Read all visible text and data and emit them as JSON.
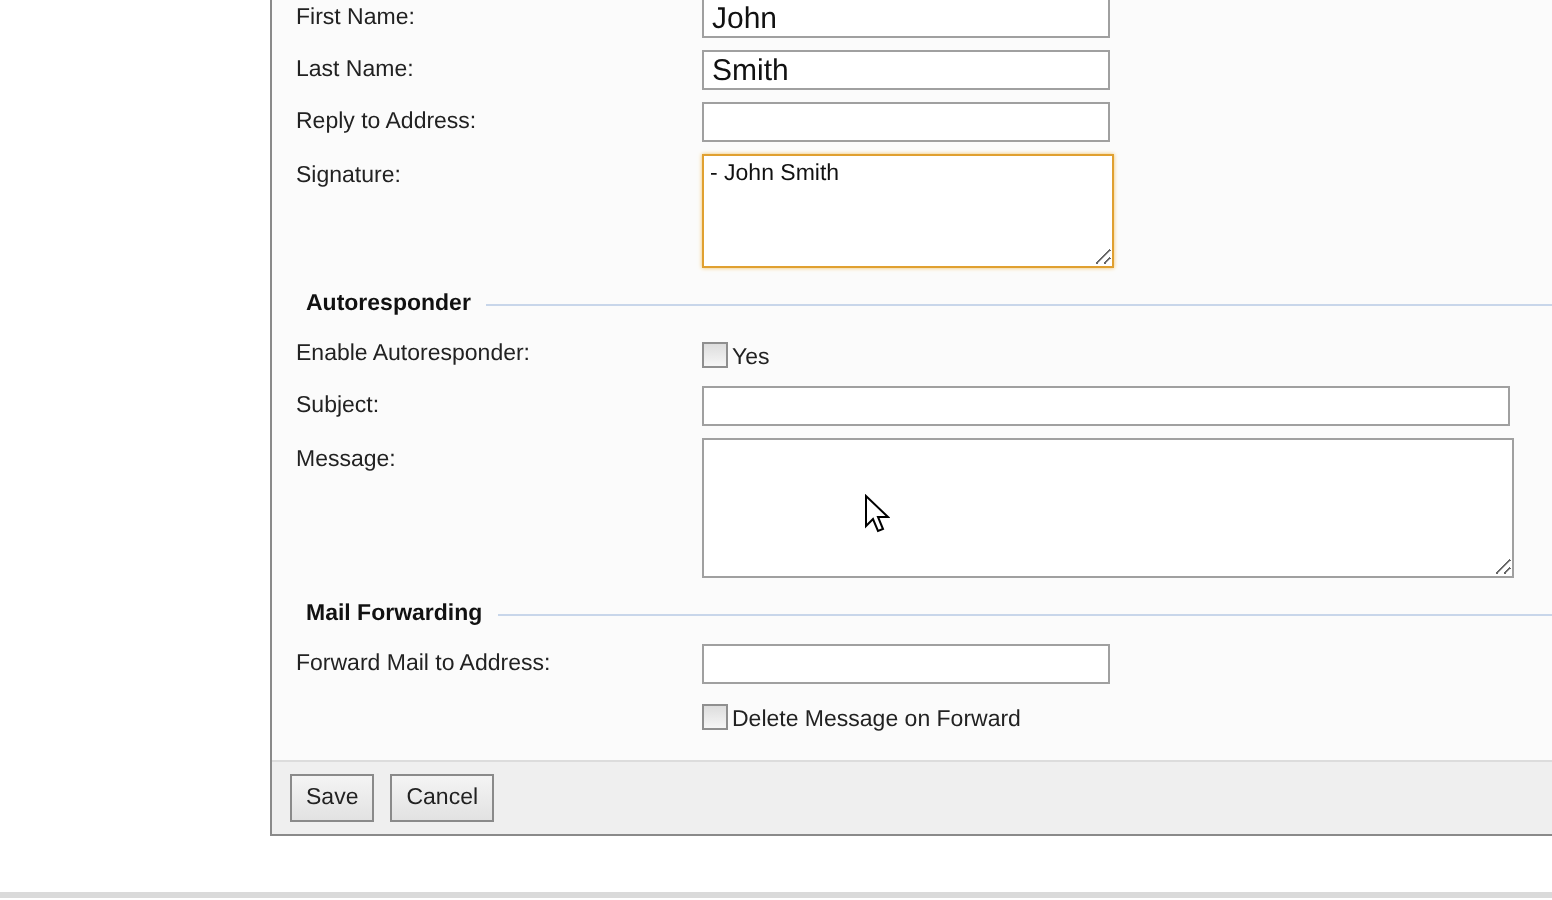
{
  "sections": [
    {
      "fields": [
        {
          "kind": "text",
          "label": "First Name:",
          "value": "John"
        },
        {
          "kind": "text",
          "label": "Last Name:",
          "value": "Smith"
        },
        {
          "kind": "text",
          "label": "Reply to Address:"
        },
        {
          "kind": "textarea",
          "label": "Signature:",
          "value": "- John Smith",
          "focused": true
        }
      ]
    },
    {
      "title": "Autoresponder",
      "fields": [
        {
          "kind": "checkbox",
          "label": "Enable Autoresponder:",
          "option": "Yes",
          "checked": false
        },
        {
          "kind": "text",
          "label": "Subject:",
          "wide": true
        },
        {
          "kind": "textarea",
          "label": "Message:",
          "wide": true
        }
      ]
    },
    {
      "title": "Mail Forwarding",
      "fields": [
        {
          "kind": "text",
          "label": "Forward Mail to Address:"
        },
        {
          "kind": "checkbox",
          "option": "Delete Message on Forward",
          "checked": false
        }
      ]
    }
  ],
  "buttons": [
    "Save",
    "Cancel"
  ]
}
